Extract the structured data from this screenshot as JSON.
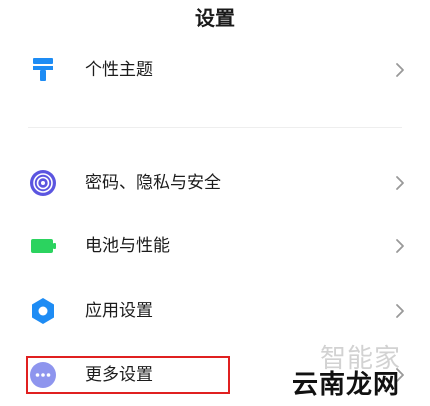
{
  "header": {
    "title": "设置"
  },
  "items": [
    {
      "label": "个性主题",
      "icon": "brush-icon",
      "color": "#1e8cf4"
    },
    {
      "label": "密码、隐私与安全",
      "icon": "fingerprint-icon",
      "color": "#5b55e0"
    },
    {
      "label": "电池与性能",
      "icon": "battery-icon",
      "color": "#2bd35f"
    },
    {
      "label": "应用设置",
      "icon": "gear-icon",
      "color": "#1e8cf4"
    },
    {
      "label": "更多设置",
      "icon": "more-icon",
      "color": "#8e95ee"
    }
  ],
  "highlight_color": "#e02020",
  "watermark": {
    "line1": "智能家",
    "line2": "云南龙网"
  }
}
